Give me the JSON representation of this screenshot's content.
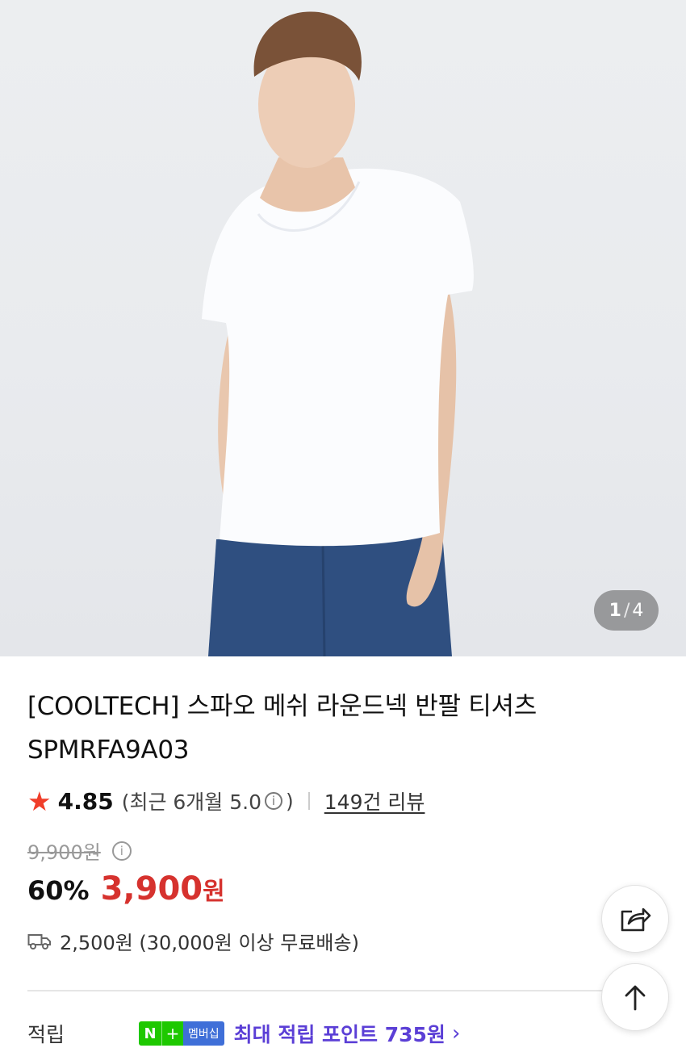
{
  "gallery": {
    "current_page": "1",
    "separator": "/",
    "total_pages": "4"
  },
  "product": {
    "title_line1": "[COOLTECH] 스파오 메쉬 라운드넥 반팔 티셔츠",
    "title_line2": "SPMRFA9A03"
  },
  "rating": {
    "score": "4.85",
    "recent_prefix": "(최근 6개월 5.0",
    "recent_suffix": ")",
    "review_link": "149건 리뷰"
  },
  "price": {
    "original": "9,900원",
    "discount": "60%",
    "sale": "3,900",
    "sale_unit": "원"
  },
  "shipping": {
    "text": "2,500원 (30,000원 이상 무료배송)"
  },
  "points": {
    "label": "적립",
    "badge_n": "N",
    "badge_plus": "+",
    "badge_membership": "멤버십",
    "text": "최대 적립 포인트 735원"
  },
  "icons": {
    "star": "star-icon",
    "info": "info-icon",
    "truck": "truck-icon",
    "share": "share-icon",
    "scroll_top": "arrow-up-icon",
    "chevron": "chevron-right-icon"
  },
  "colors": {
    "sale_red": "#d6322e",
    "star_red": "#f03e2a",
    "points_purple": "#5b3fd6",
    "naver_green": "#1ec800"
  }
}
